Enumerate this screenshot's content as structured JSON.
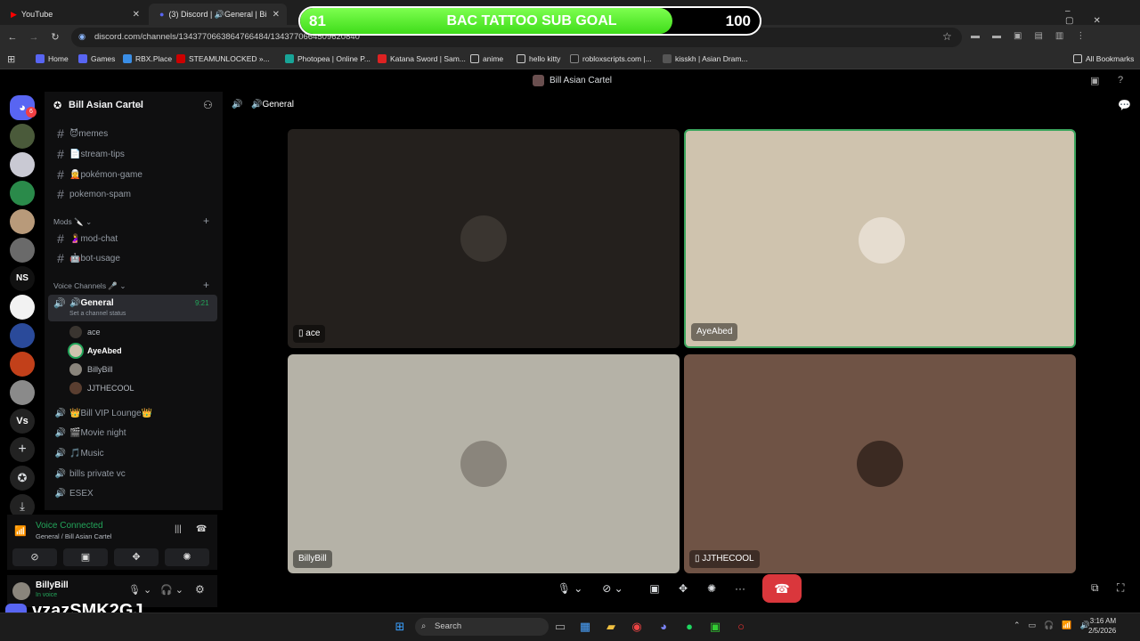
{
  "browser": {
    "tabs": [
      {
        "label": "YouTube"
      },
      {
        "label": "(3) Discord | 🔊General | Bill"
      }
    ],
    "url": "discord.com/channels/1343770663864766484/1343770664509620840",
    "bookmarks": [
      "Home",
      "Games",
      "RBX.Place",
      "STEAMUNLOCKED »...",
      "Photopea | Online P...",
      "Katana Sword | Sam...",
      "anime",
      "hello kitty",
      "robloxscripts.com |...",
      "kisskh | Asian Dram..."
    ],
    "all_bookmarks": "All Bookmarks"
  },
  "goal": {
    "current": "81",
    "title": "BAC TATTOO SUB GOAL",
    "target": "100",
    "progress_fraction": 0.81
  },
  "discord": {
    "window_title": "Bill Asian Cartel",
    "guild_badge": "6",
    "guild_initials": [
      "NS",
      "Vs"
    ],
    "server_name": "Bill Asian Cartel",
    "channels_top": [
      "😈memes",
      "📄stream-tips",
      "🧝pokémon-game",
      "pokemon-spam"
    ],
    "category_mods": "Mods 🔪",
    "channels_mods": [
      "🤰mod-chat",
      "🤖bot-usage"
    ],
    "category_voice": "Voice Channels 🎤",
    "voice_active": {
      "name": "🔊General",
      "time": "9:21",
      "status": "Set a channel status"
    },
    "voice_users": [
      "ace",
      "AyeAbed",
      "BillyBill",
      "JJTHECOOL"
    ],
    "voice_other": [
      "👑Bill VIP Lounge👑",
      "🎬Movie night",
      "🎵Music",
      "bills private vc",
      "ESEX"
    ],
    "voice_connected": {
      "title": "Voice Connected",
      "sub": "General / Bill Asian Cartel"
    },
    "user": {
      "name": "BillyBill",
      "status": "In voice"
    },
    "stage_title": "🔊General",
    "tiles": [
      {
        "name": "ace",
        "bg": "#24201d",
        "face": "#3a3530"
      },
      {
        "name": "AyeAbed",
        "bg": "#cfc3ae",
        "face": "#e6ddd0"
      },
      {
        "name": "BillyBill",
        "bg": "#b5b2a7",
        "face": "#8a857c"
      },
      {
        "name": "JJTHECOOL",
        "bg": "#6f5345",
        "face": "#3b2a22"
      }
    ]
  },
  "overlay_handle": "vzazSMK2GJ",
  "taskbar": {
    "search": "Search",
    "time": "3:16 AM",
    "date": "2/5/2026"
  }
}
